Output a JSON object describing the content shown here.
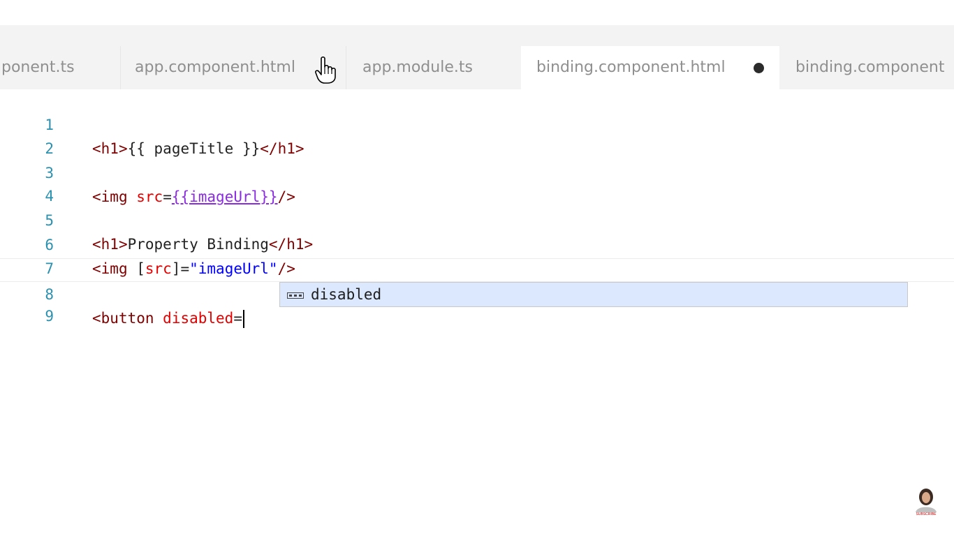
{
  "tabs": [
    {
      "label": "ponent.ts",
      "active": false
    },
    {
      "label": "app.component.html",
      "active": false
    },
    {
      "label": "app.module.ts",
      "active": false
    },
    {
      "label": "binding.component.html",
      "active": true,
      "dirty": true
    },
    {
      "label": "binding.component",
      "active": false
    }
  ],
  "editor": {
    "lines": [
      {
        "number": "1",
        "parts": [
          {
            "t": "<",
            "c": "br"
          },
          {
            "t": "h1",
            "c": "tag"
          },
          {
            "t": ">",
            "c": "br"
          },
          {
            "t": "{{ pageTitle }}",
            "c": "txt"
          },
          {
            "t": "</",
            "c": "br"
          },
          {
            "t": "h1",
            "c": "tag"
          },
          {
            "t": ">",
            "c": "br"
          }
        ]
      },
      {
        "number": "2",
        "parts": []
      },
      {
        "number": "3",
        "parts": [
          {
            "t": "<",
            "c": "br"
          },
          {
            "t": "img",
            "c": "tag"
          },
          {
            "t": " ",
            "c": "txt"
          },
          {
            "t": "src",
            "c": "attr"
          },
          {
            "t": "=",
            "c": "txt"
          },
          {
            "t": "{{imageUrl}}",
            "c": "link"
          },
          {
            "t": "/>",
            "c": "br"
          }
        ]
      },
      {
        "number": "4",
        "parts": []
      },
      {
        "number": "5",
        "parts": [
          {
            "t": "<",
            "c": "br"
          },
          {
            "t": "h1",
            "c": "tag"
          },
          {
            "t": ">",
            "c": "br"
          },
          {
            "t": "Property Binding",
            "c": "txt"
          },
          {
            "t": "</",
            "c": "br"
          },
          {
            "t": "h1",
            "c": "tag"
          },
          {
            "t": ">",
            "c": "br"
          }
        ]
      },
      {
        "number": "6",
        "parts": [
          {
            "t": "<",
            "c": "br"
          },
          {
            "t": "img",
            "c": "tag"
          },
          {
            "t": " [",
            "c": "txt"
          },
          {
            "t": "src",
            "c": "attr"
          },
          {
            "t": "]=",
            "c": "txt"
          },
          {
            "t": "\"imageUrl\"",
            "c": "str"
          },
          {
            "t": "/>",
            "c": "br"
          }
        ]
      },
      {
        "number": "7",
        "parts": []
      },
      {
        "number": "8",
        "current": true,
        "parts": [
          {
            "t": "<",
            "c": "br"
          },
          {
            "t": "button",
            "c": "tag"
          },
          {
            "t": " ",
            "c": "txt"
          },
          {
            "t": "disabled",
            "c": "attr"
          },
          {
            "t": "=",
            "c": "txt"
          }
        ]
      },
      {
        "number": "9",
        "parts": []
      }
    ]
  },
  "suggestion": {
    "label": "disabled",
    "icon": "text-snippet-icon"
  },
  "subscribe": {
    "label": "SUBSCRIBE",
    "icon": "avatar-icon"
  },
  "colors": {
    "line_number": "#2b91af",
    "tag": "#800000",
    "attribute": "#e50000",
    "string": "#0000ff",
    "interpolation_link": "#8a2be2",
    "suggestion_bg": "#dbe8fd"
  }
}
